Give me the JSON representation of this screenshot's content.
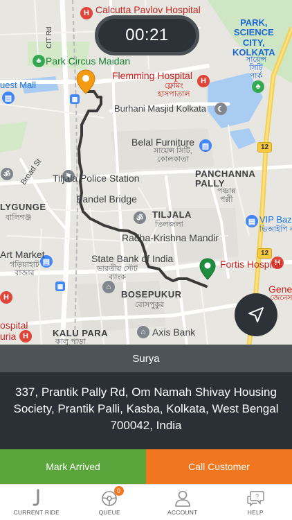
{
  "timer": "00:21",
  "map": {
    "labels": {
      "calcutta_pavlov": "Calcutta Pavlov Hospital",
      "park_circus": "Park Circus Maidan",
      "quest_mall": "uest Mall",
      "flemming": "Flemming Hospital",
      "flemming_bn": "ফ্লেমিং\nহাসপাতাল",
      "burhani": "Burhani Masjid Kolkata",
      "science_city": "PARK,\nSCIENCE\nCITY,\nKOLKATA",
      "science_city_bn": "সায়েন্স\nসিটি\nপার্ক",
      "belal": "Belal Furniture",
      "belal_bn": "সায়েন্স সিটি,\nকোলকাতা",
      "panchanna": "PANCHANNA\nPALLY",
      "panchanna_bn": "পঞ্চান্ন\nপল্লী",
      "tiljala_police": "Tiljala Police Station",
      "bandel_bridge": "Bandel Bridge",
      "broad_st": "Broad St",
      "ballygunge": "LYGUNGE",
      "ballygunge_bn": "বালিগঞ্জ",
      "tiljala": "TILJALA",
      "tiljala_bn": "তিলজলা",
      "vip_baz": "VIP Baz",
      "vip_baz_bn": "ভিআইপি ব",
      "radha_krishna": "Radha-Krishna Mandir",
      "art_market": "Art Market",
      "art_market_bn": "গড়িয়াহাট\nবাজার",
      "sbi": "State Bank of India",
      "sbi_bn": "ভারতীয় স্টেট\nব্যাংক",
      "fortis": "Fortis Hospital",
      "genes": "Genes",
      "genes_bn": "জেনেস",
      "bosepukur": "BOSEPUKUR",
      "bosepukur_bn": "বোসপুকুর",
      "kalu_para": "KALU PARA",
      "kalu_para_bn": "কালু পাড়া",
      "axis_bank": "Axis Bank",
      "hospital_left": "ospital",
      "uria": "uria",
      "cit_rd": "CIT Rd",
      "road_12a": "12",
      "road_12b": "12"
    }
  },
  "customer": {
    "name": "Surya",
    "address": "337, Prantik Pally Rd, Om Namah Shivay Housing Society, Prantik Palli, Kasba, Kolkata, West Bengal 700042, India"
  },
  "actions": {
    "mark_arrived": "Mark Arrived",
    "call_customer": "Call Customer"
  },
  "tabs": [
    {
      "label": "CURRENT RIDE",
      "icon": "ride-icon"
    },
    {
      "label": "QUEUE",
      "icon": "steering-wheel-icon",
      "badge": "0"
    },
    {
      "label": "ACCOUNT",
      "icon": "user-icon"
    },
    {
      "label": "HELP",
      "icon": "help-chat-icon"
    }
  ],
  "colors": {
    "timer_bg": "#2d3238",
    "arrived": "#5aa53c",
    "call": "#f0771f",
    "route": "#3a3a3a",
    "pickup_pin": "#f39c12",
    "dropoff_pin": "#1e8e3e"
  }
}
